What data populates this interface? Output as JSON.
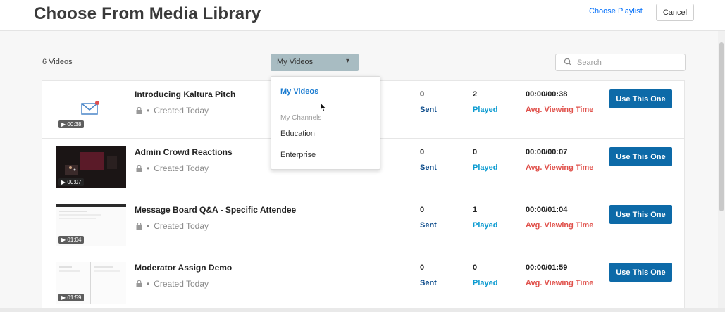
{
  "header": {
    "title": "Choose From Media Library",
    "choose_playlist": "Choose Playlist",
    "cancel": "Cancel"
  },
  "toolbar": {
    "count": "6 Videos",
    "filter_selected": "My Videos",
    "search_placeholder": "Search"
  },
  "dropdown": {
    "selected": "My Videos",
    "group_label": "My Channels",
    "items": [
      "Education",
      "Enterprise"
    ]
  },
  "labels": {
    "sent": "Sent",
    "played": "Played",
    "avg": "Avg. Viewing Time",
    "meta": "Created Today",
    "use_button": "Use This One"
  },
  "videos": [
    {
      "title": "Introducing Kaltura Pitch",
      "duration": "00:38",
      "sent": "0",
      "played": "2",
      "viewing": "00:00/00:38",
      "thumb": "envelope"
    },
    {
      "title": "Admin Crowd Reactions",
      "duration": "00:07",
      "sent": "0",
      "played": "0",
      "viewing": "00:00/00:07",
      "thumb": "dark-stage"
    },
    {
      "title": "Message Board Q&A - Specific Attendee",
      "duration": "01:04",
      "sent": "0",
      "played": "1",
      "viewing": "00:00/01:04",
      "thumb": "screen"
    },
    {
      "title": "Moderator Assign Demo",
      "duration": "01:59",
      "sent": "0",
      "played": "0",
      "viewing": "00:00/01:59",
      "thumb": "screen"
    }
  ],
  "colors": {
    "accent": "#0d6aa8",
    "link": "#006efa",
    "sent_label": "#0a4a8a",
    "played_label": "#0a9ad0",
    "avg_label": "#e0504a",
    "filter_bg": "#a8bcc2"
  }
}
